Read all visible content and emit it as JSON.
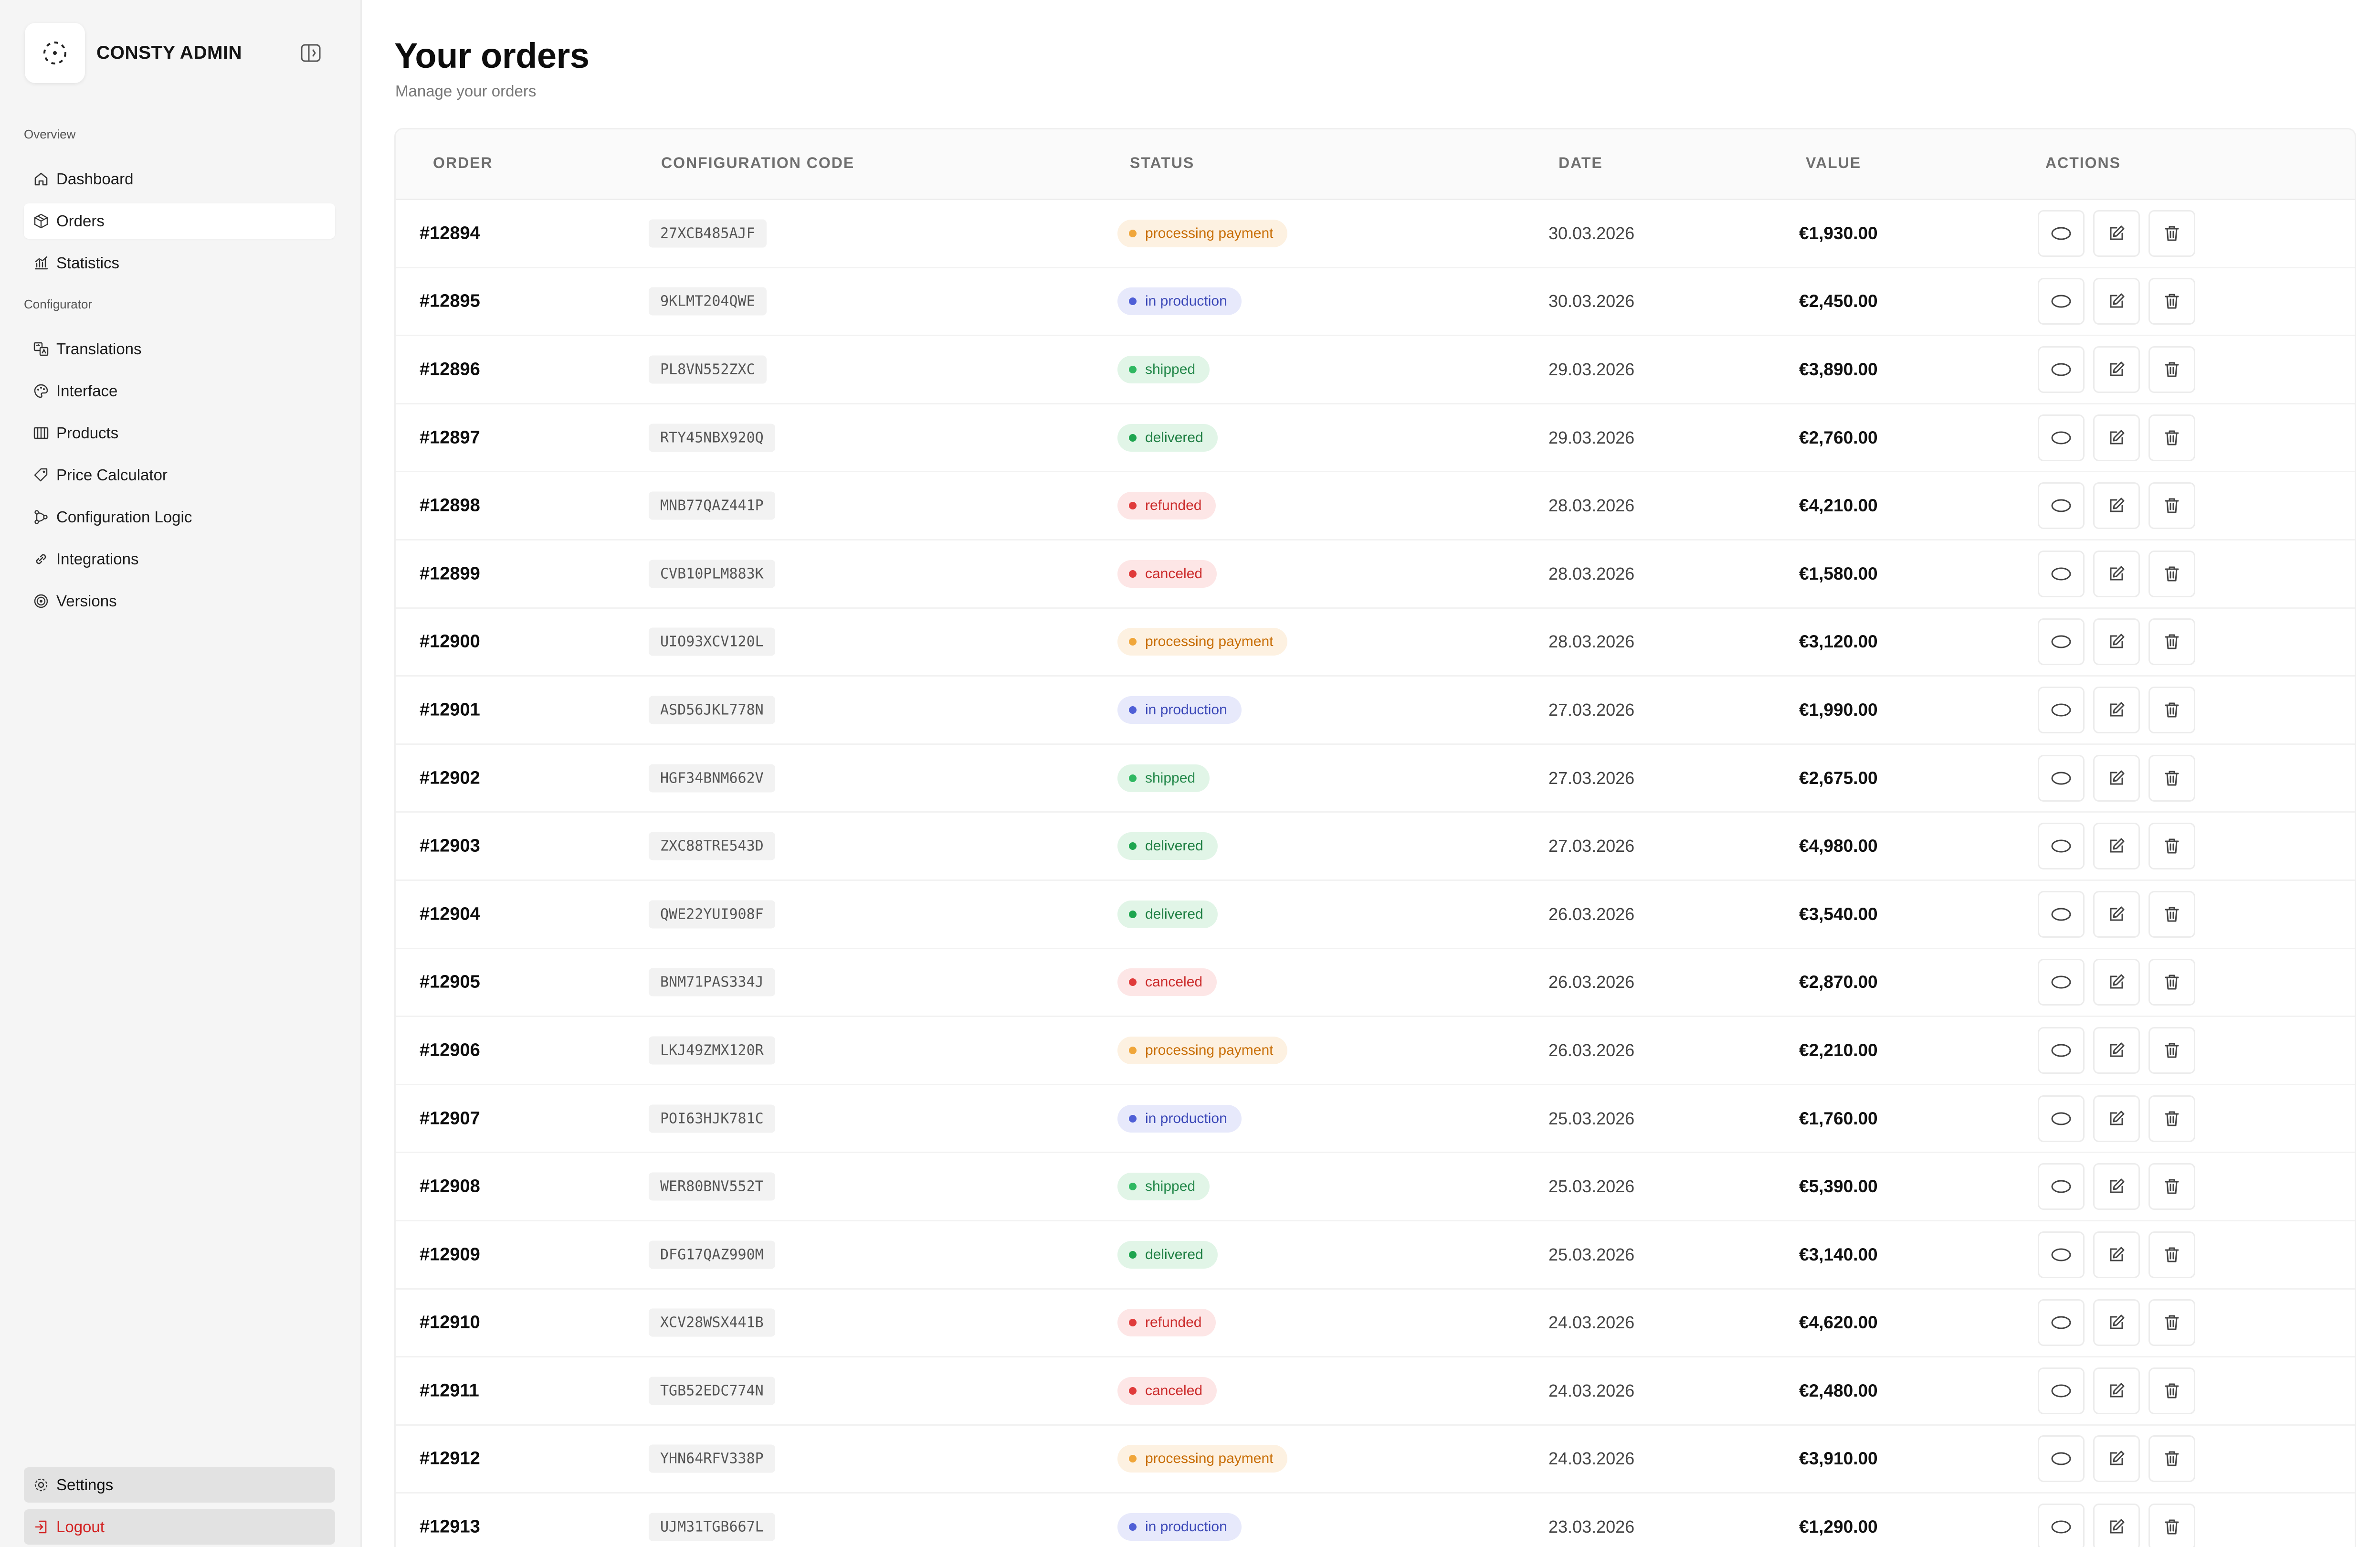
{
  "brand": {
    "name": "CONSTY ADMIN"
  },
  "sidebar": {
    "sections": [
      {
        "label": "Overview",
        "items": [
          {
            "label": "Dashboard",
            "icon": "home-icon"
          },
          {
            "label": "Orders",
            "icon": "box-icon",
            "active": true
          },
          {
            "label": "Statistics",
            "icon": "chart-icon"
          }
        ]
      },
      {
        "label": "Configurator",
        "items": [
          {
            "label": "Translations",
            "icon": "translate-icon"
          },
          {
            "label": "Interface",
            "icon": "palette-icon"
          },
          {
            "label": "Products",
            "icon": "grid-icon"
          },
          {
            "label": "Price Calculator",
            "icon": "tag-icon"
          },
          {
            "label": "Configuration Logic",
            "icon": "flow-icon"
          },
          {
            "label": "Integrations",
            "icon": "link-icon"
          },
          {
            "label": "Versions",
            "icon": "versions-icon"
          }
        ]
      }
    ],
    "settings_label": "Settings",
    "logout_label": "Logout"
  },
  "page": {
    "title": "Your orders",
    "subtitle": "Manage your orders"
  },
  "table": {
    "columns": [
      "ORDER",
      "CONFIGURATION CODE",
      "STATUS",
      "DATE",
      "VALUE",
      "ACTIONS"
    ],
    "rows": [
      {
        "order": "#12894",
        "code": "27XCB485AJF",
        "status": "processing payment",
        "date": "30.03.2026",
        "value": "€1,930.00"
      },
      {
        "order": "#12895",
        "code": "9KLMT204QWE",
        "status": "in production",
        "date": "30.03.2026",
        "value": "€2,450.00"
      },
      {
        "order": "#12896",
        "code": "PL8VN552ZXC",
        "status": "shipped",
        "date": "29.03.2026",
        "value": "€3,890.00"
      },
      {
        "order": "#12897",
        "code": "RTY45NBX920Q",
        "status": "delivered",
        "date": "29.03.2026",
        "value": "€2,760.00"
      },
      {
        "order": "#12898",
        "code": "MNB77QAZ441P",
        "status": "refunded",
        "date": "28.03.2026",
        "value": "€4,210.00"
      },
      {
        "order": "#12899",
        "code": "CVB10PLM883K",
        "status": "canceled",
        "date": "28.03.2026",
        "value": "€1,580.00"
      },
      {
        "order": "#12900",
        "code": "UIO93XCV120L",
        "status": "processing payment",
        "date": "28.03.2026",
        "value": "€3,120.00"
      },
      {
        "order": "#12901",
        "code": "ASD56JKL778N",
        "status": "in production",
        "date": "27.03.2026",
        "value": "€1,990.00"
      },
      {
        "order": "#12902",
        "code": "HGF34BNM662V",
        "status": "shipped",
        "date": "27.03.2026",
        "value": "€2,675.00"
      },
      {
        "order": "#12903",
        "code": "ZXC88TRE543D",
        "status": "delivered",
        "date": "27.03.2026",
        "value": "€4,980.00"
      },
      {
        "order": "#12904",
        "code": "QWE22YUI908F",
        "status": "delivered",
        "date": "26.03.2026",
        "value": "€3,540.00"
      },
      {
        "order": "#12905",
        "code": "BNM71PAS334J",
        "status": "canceled",
        "date": "26.03.2026",
        "value": "€2,870.00"
      },
      {
        "order": "#12906",
        "code": "LKJ49ZMX120R",
        "status": "processing payment",
        "date": "26.03.2026",
        "value": "€2,210.00"
      },
      {
        "order": "#12907",
        "code": "POI63HJK781C",
        "status": "in production",
        "date": "25.03.2026",
        "value": "€1,760.00"
      },
      {
        "order": "#12908",
        "code": "WER80BNV552T",
        "status": "shipped",
        "date": "25.03.2026",
        "value": "€5,390.00"
      },
      {
        "order": "#12909",
        "code": "DFG17QAZ990M",
        "status": "delivered",
        "date": "25.03.2026",
        "value": "€3,140.00"
      },
      {
        "order": "#12910",
        "code": "XCV28WSX441B",
        "status": "refunded",
        "date": "24.03.2026",
        "value": "€4,620.00"
      },
      {
        "order": "#12911",
        "code": "TGB52EDC774N",
        "status": "canceled",
        "date": "24.03.2026",
        "value": "€2,480.00"
      },
      {
        "order": "#12912",
        "code": "YHN64RFV338P",
        "status": "processing payment",
        "date": "24.03.2026",
        "value": "€3,910.00"
      },
      {
        "order": "#12913",
        "code": "UJM31TGB667L",
        "status": "in production",
        "date": "23.03.2026",
        "value": "€1,290.00"
      }
    ]
  },
  "status_colors": {
    "processing payment": {
      "bg": "#fdf1e1",
      "fg": "#c86e06",
      "dot": "#f0a63a"
    },
    "in production": {
      "bg": "#e7e9fb",
      "fg": "#3c49b8",
      "dot": "#4f5fd6"
    },
    "shipped": {
      "bg": "#e1f5e7",
      "fg": "#23884a",
      "dot": "#2fb861"
    },
    "delivered": {
      "bg": "#e1f5e7",
      "fg": "#1f7f43",
      "dot": "#1ea54f"
    },
    "refunded": {
      "bg": "#fde6e6",
      "fg": "#cc2d2d",
      "dot": "#e03b3b"
    },
    "canceled": {
      "bg": "#fde6e6",
      "fg": "#cc2d2d",
      "dot": "#e03b3b"
    }
  },
  "row_actions": [
    "eye-icon",
    "edit-icon",
    "trash-icon"
  ]
}
